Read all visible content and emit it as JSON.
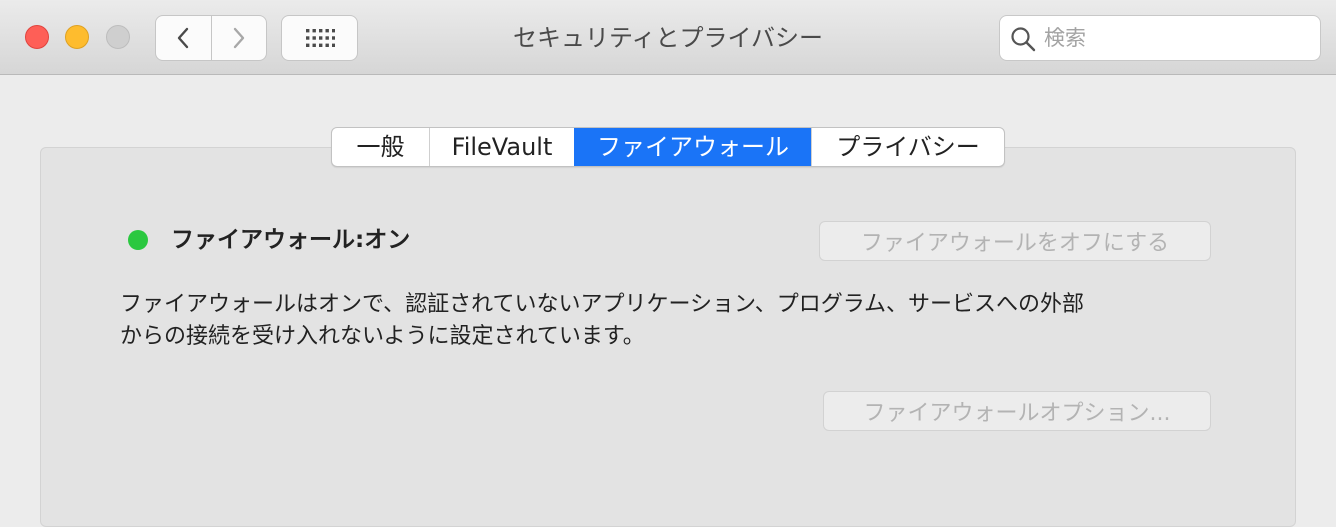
{
  "window": {
    "title": "セキュリティとプライバシー",
    "traffic_lights": {
      "close_color": "#fe5f57",
      "minimize_color": "#febc2e",
      "zoom_color": "#cfcfcf"
    },
    "nav": {
      "back_icon": "chevron-left-icon",
      "forward_icon": "chevron-right-icon",
      "show_all_icon": "grid-icon"
    },
    "search": {
      "placeholder": "検索",
      "value": "",
      "icon": "search-icon"
    }
  },
  "tabs": [
    {
      "label": "一般",
      "active": false
    },
    {
      "label": "FileVault",
      "active": false
    },
    {
      "label": "ファイアウォール",
      "active": true
    },
    {
      "label": "プライバシー",
      "active": false
    }
  ],
  "firewall": {
    "status_color": "#2bc840",
    "status_label": "ファイアウォール:オン",
    "turn_off_button": "ファイアウォールをオフにする",
    "description": "ファイアウォールはオンで、認証されていないアプリケーション、プログラム、サービスへの外部\nからの接続を受け入れないように設定されています。",
    "options_button": "ファイアウォールオプション..."
  },
  "accent_color": "#1a74f7"
}
